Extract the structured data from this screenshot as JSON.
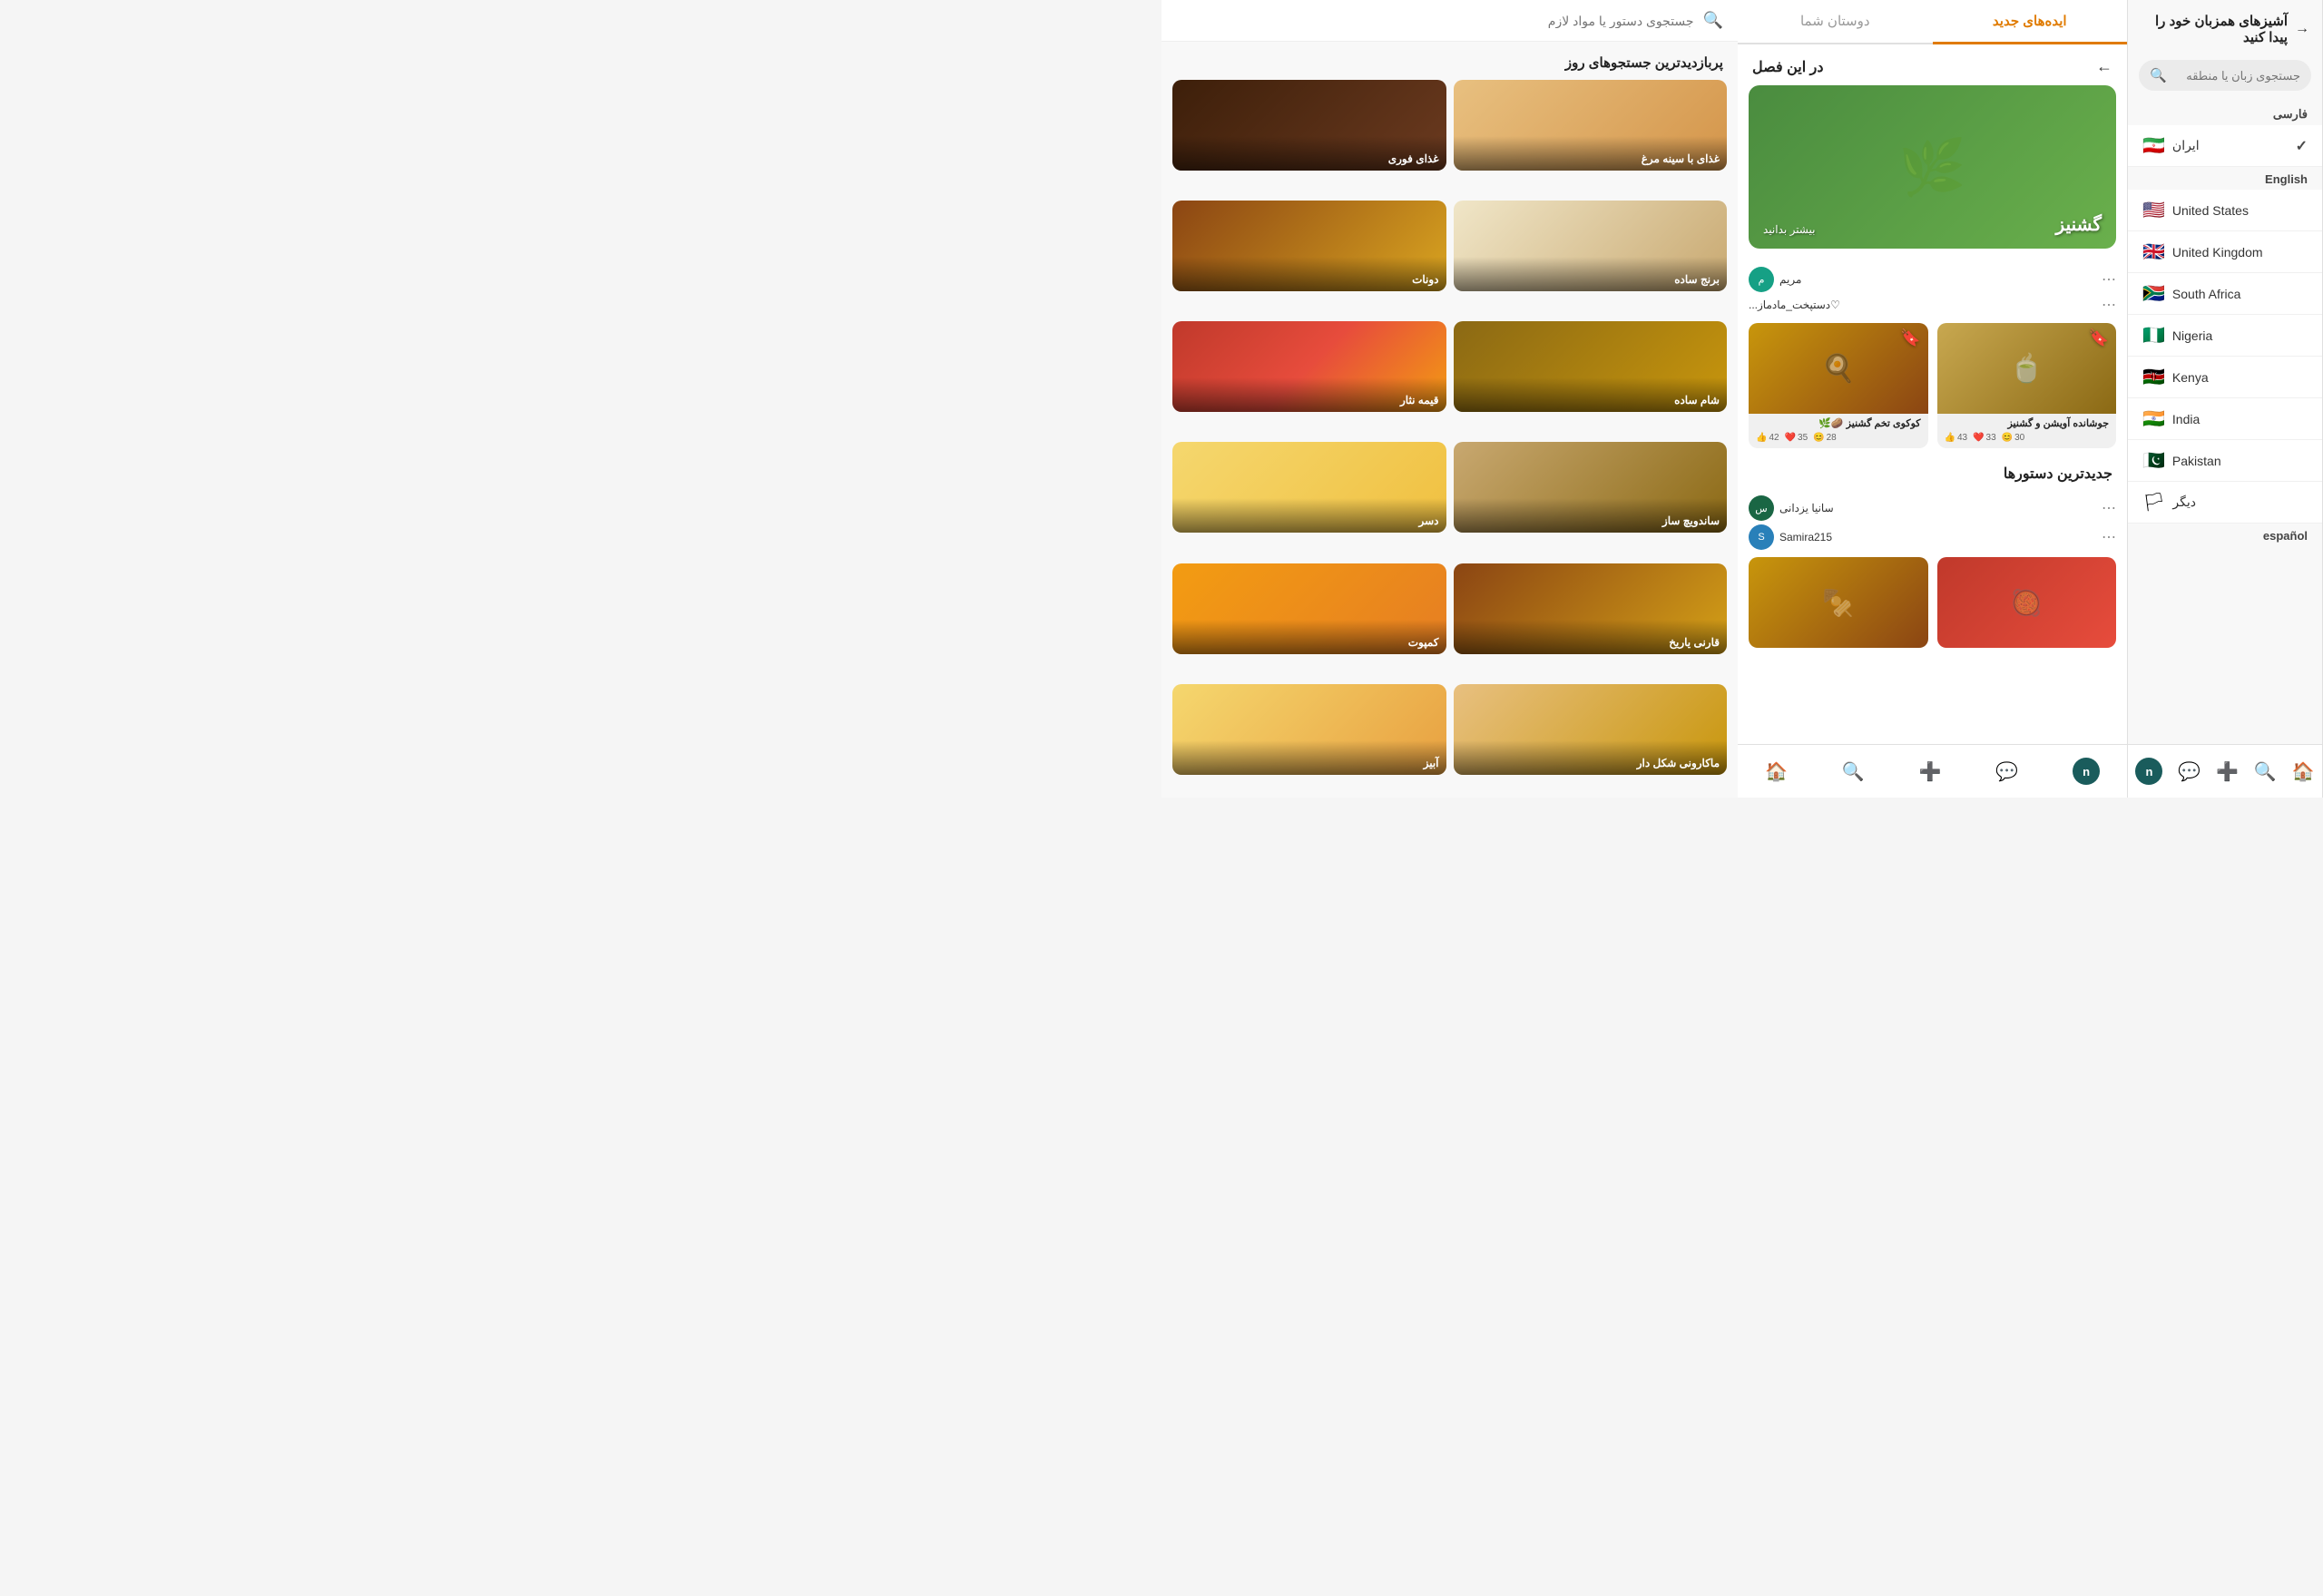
{
  "leftPanel": {
    "header": "آشیزهای همزبان خود را پیدا کنید",
    "searchPlaceholder": "جستجوی زبان یا منطقه",
    "sections": [
      {
        "label": "فارسی",
        "items": [
          {
            "name": "ایران",
            "flag": "🇮🇷",
            "selected": true
          }
        ]
      },
      {
        "label": "English",
        "items": [
          {
            "name": "United States",
            "flag": "🇺🇸",
            "selected": false
          },
          {
            "name": "United Kingdom",
            "flag": "🇬🇧",
            "selected": false
          },
          {
            "name": "South Africa",
            "flag": "🇿🇦",
            "selected": false
          },
          {
            "name": "Nigeria",
            "flag": "🇳🇬",
            "selected": false
          },
          {
            "name": "Kenya",
            "flag": "🇰🇪",
            "selected": false
          },
          {
            "name": "India",
            "flag": "🇮🇳",
            "selected": false
          },
          {
            "name": "Pakistan",
            "flag": "🇵🇰",
            "selected": false
          },
          {
            "name": "دیگر",
            "flag": "🏳",
            "selected": false
          }
        ]
      },
      {
        "label": "español",
        "items": []
      }
    ]
  },
  "middlePanel": {
    "tabs": [
      {
        "label": "ایده‌های جدید",
        "active": true
      },
      {
        "label": "دوستان شما",
        "active": false
      }
    ],
    "inSeason": {
      "title": "در این فصل",
      "heroTitle": "گشنیز",
      "heroSub": "بیشتر بدانید"
    },
    "users": [
      {
        "name": "مریم",
        "username": "♡دستپخت_مادماز...",
        "avatarColor": "avatar-teal",
        "initial": "م"
      },
      {
        "name": "سانیا یزدانی",
        "username": "Samira215",
        "avatarColor": "avatar-green",
        "initial": "س"
      }
    ],
    "recipeCards": [
      {
        "title": "جوشانده آویشن و گشنیز",
        "bgClass": "food-tea",
        "stats": [
          {
            "count": "43",
            "emoji": "👍"
          },
          {
            "count": "33",
            "emoji": "❤️"
          },
          {
            "count": "30",
            "emoji": "😊"
          }
        ]
      },
      {
        "title": "کوکوی تخم گشنیز 🥔🌿",
        "bgClass": "food-kotlet",
        "stats": [
          {
            "count": "42",
            "emoji": "👍"
          },
          {
            "count": "35",
            "emoji": "❤️"
          },
          {
            "count": "28",
            "emoji": "😊"
          }
        ]
      }
    ],
    "newestTitle": "جدیدترین دستورها",
    "newestCards": [
      {
        "bgClass": "food-red"
      },
      {
        "bgClass": "food-meatball"
      }
    ]
  },
  "rightPanel": {
    "searchPlaceholder": "جستجوی دستور یا مواد لازم",
    "trendingTitle": "پربازدیدترین جستجوهای روز",
    "trendingItems": [
      {
        "label": "غذای با سینه مرغ",
        "bgClass": "food-chicken"
      },
      {
        "label": "غذای فوری",
        "bgClass": "food-chocolate"
      },
      {
        "label": "برنج ساده",
        "bgClass": "food-rice"
      },
      {
        "label": "دونات",
        "bgClass": "food-donut"
      },
      {
        "label": "شام ساده",
        "bgClass": "food-stew"
      },
      {
        "label": "قیمه نثار",
        "bgClass": "food-pomegranate"
      },
      {
        "label": "ساندویچ ساز",
        "bgClass": "food-sandwich"
      },
      {
        "label": "دسر",
        "bgClass": "food-dessert"
      },
      {
        "label": "قارنی یاریخ",
        "bgClass": "food-turnip"
      },
      {
        "label": "کمپوت",
        "bgClass": "food-persimmon"
      },
      {
        "label": "ماکارونی شکل دار",
        "bgClass": "food-pasta"
      },
      {
        "label": "آبیز",
        "bgClass": "food-broth"
      }
    ]
  },
  "bottomNav": {
    "items": [
      {
        "icon": "🏠",
        "label": "home",
        "active": true
      },
      {
        "icon": "🔍",
        "label": "search",
        "active": false
      },
      {
        "icon": "➕",
        "label": "add",
        "active": false
      },
      {
        "icon": "💬",
        "label": "chat",
        "active": false
      },
      {
        "icon": "n",
        "label": "profile",
        "active": false
      }
    ]
  }
}
